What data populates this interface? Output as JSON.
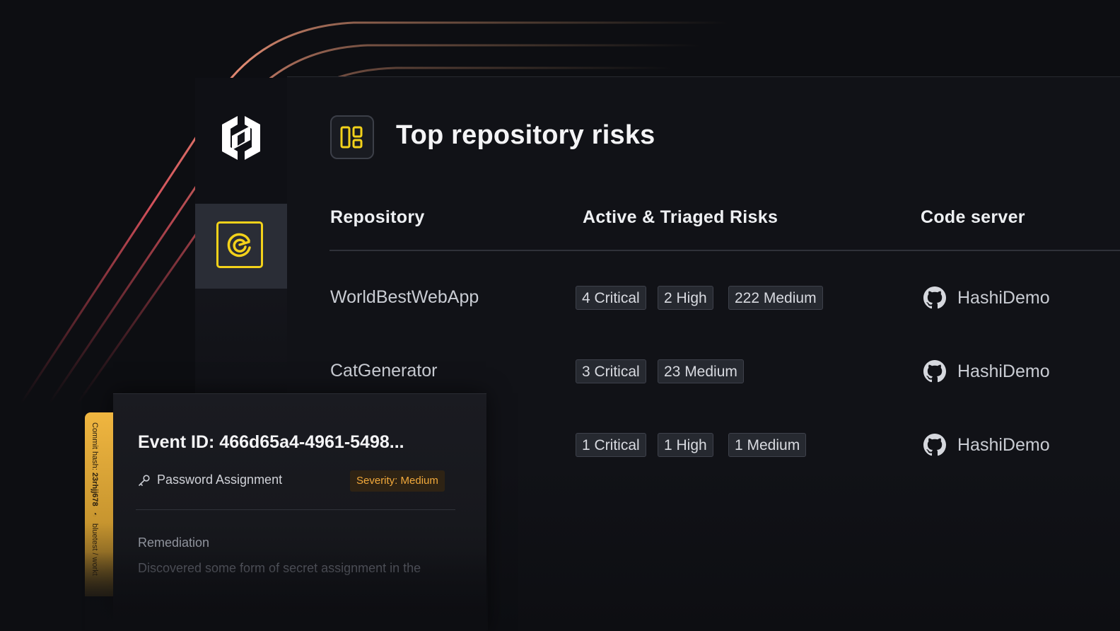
{
  "app": {
    "logo_name": "HashiCorp"
  },
  "colors": {
    "accent": "#f3d21a",
    "severity_medium": "#f2a93b",
    "background": "#0d0e12"
  },
  "page": {
    "title": "Top repository risks",
    "title_icon": "dashboard-layout-icon"
  },
  "sidebar": {
    "active_item_icon": "radar-scan-icon"
  },
  "table": {
    "headers": {
      "repository": "Repository",
      "risks": "Active & Triaged Risks",
      "server": "Code server"
    },
    "rows": [
      {
        "repository": "WorldBestWebApp",
        "risks": [
          "4 Critical",
          "2 High",
          "222 Medium"
        ],
        "server": "HashiDemo",
        "server_icon": "github-icon"
      },
      {
        "repository": "CatGenerator",
        "risks": [
          "3 Critical",
          "23 Medium"
        ],
        "server": "HashiDemo",
        "server_icon": "github-icon"
      },
      {
        "repository": "",
        "risks": [
          "1 Critical",
          "1 High",
          "1 Medium"
        ],
        "server": "HashiDemo",
        "server_icon": "github-icon"
      }
    ]
  },
  "event_card": {
    "commit_label": "Commit hash:",
    "commit_hash": "23rhjj678",
    "branch": "bluetest / workt",
    "title": "Event ID: 466d65a4-4961-5498...",
    "type": "Password Assignment",
    "type_icon": "key-icon",
    "severity": "Severity: Medium",
    "remediation_label": "Remediation",
    "remediation_text": "Discovered some form of secret assignment in the"
  }
}
